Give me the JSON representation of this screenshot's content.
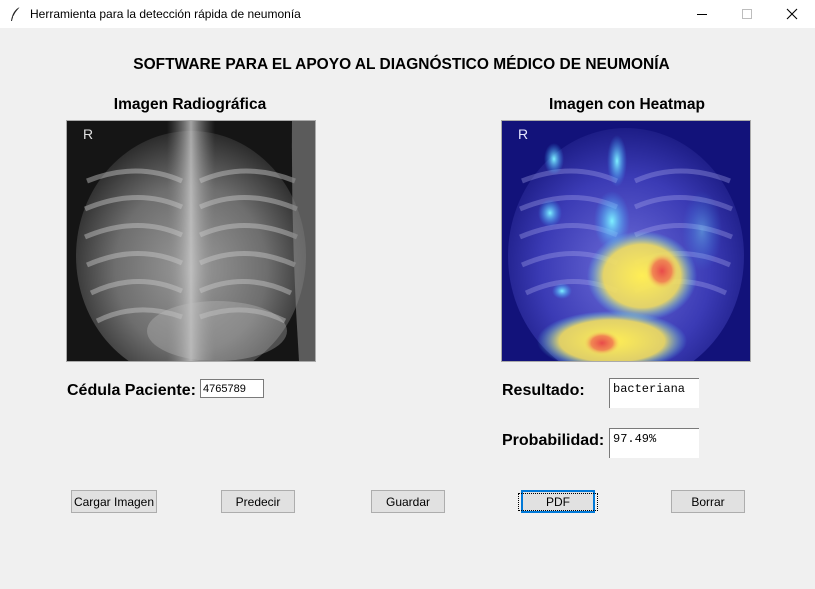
{
  "window": {
    "title": "Herramienta para la detección rápida de neumonía",
    "icon": "feather-icon"
  },
  "heading": "SOFTWARE PARA EL APOYO AL DIAGNÓSTICO MÉDICO DE NEUMONÍA",
  "left_panel": {
    "title": "Imagen Radiográfica",
    "image_marker": "R"
  },
  "right_panel": {
    "title": "Imagen con Heatmap",
    "image_marker": "R"
  },
  "patient": {
    "label": "Cédula Paciente:",
    "value": "4765789"
  },
  "result": {
    "label": "Resultado:",
    "value": "bacteriana"
  },
  "probability": {
    "label": "Probabilidad:",
    "value": "97.49%"
  },
  "buttons": {
    "load": "Cargar Imagen",
    "predict": "Predecir",
    "save": "Guardar",
    "pdf": "PDF",
    "clear": "Borrar"
  },
  "colors": {
    "background": "#f0f0f0",
    "button": "#e1e1e1",
    "focus": "#0078d7"
  }
}
